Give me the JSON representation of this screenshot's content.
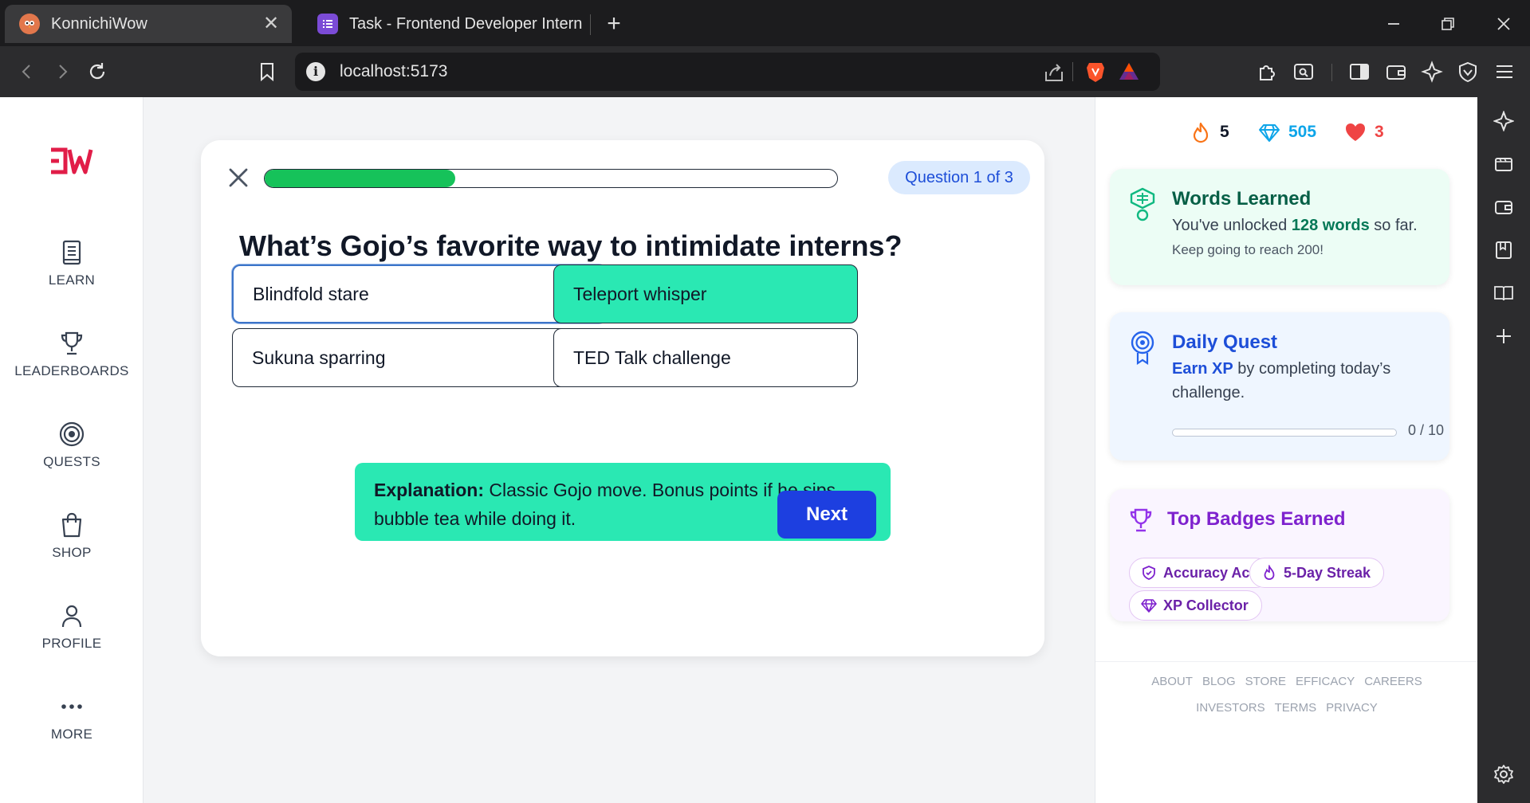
{
  "browser": {
    "tabs": [
      {
        "title": "KonnichiWow",
        "active": true
      },
      {
        "title": "Task - Frontend Developer Intern",
        "active": false
      }
    ],
    "url": "localhost:5173"
  },
  "sidebar": {
    "logo": "JW",
    "items": [
      {
        "label": "LEARN",
        "icon": "book-icon"
      },
      {
        "label": "LEADERBOARDS",
        "icon": "trophy-icon"
      },
      {
        "label": "QUESTS",
        "icon": "target-icon"
      },
      {
        "label": "SHOP",
        "icon": "shopping-bag-icon"
      },
      {
        "label": "PROFILE",
        "icon": "user-icon"
      },
      {
        "label": "MORE",
        "icon": "more-dots-icon"
      }
    ]
  },
  "quiz": {
    "progress_fraction": 0.333,
    "question_counter": "Question 1 of 3",
    "question": "What’s Gojo’s favorite way to intimidate interns?",
    "options": [
      "Blindfold stare",
      "Teleport whisper",
      "Sukuna sparring",
      "TED Talk challenge"
    ],
    "selected_option": "Blindfold stare",
    "correct_option": "Teleport whisper",
    "explanation_label": "Explanation:",
    "explanation_text": "Classic Gojo move. Bonus points if he sips bubble tea while doing it.",
    "next_label": "Next"
  },
  "stats": {
    "streak": "5",
    "gems": "505",
    "hearts": "3"
  },
  "words_card": {
    "title": "Words Learned",
    "text_prefix": "You've unlocked",
    "text_highlight": "128 words",
    "text_suffix": "so far.",
    "subtext": "Keep going to reach 200!"
  },
  "quest_card": {
    "title": "Daily Quest",
    "text_highlight": "Earn XP",
    "text_rest": "by completing today’s challenge.",
    "progress": "0 / 10",
    "progress_fraction": 0
  },
  "badges_card": {
    "title": "Top Badges Earned",
    "badges": [
      "Accuracy Ace",
      "5-Day Streak",
      "XP Collector"
    ]
  },
  "footer": {
    "row1": [
      "ABOUT",
      "BLOG",
      "STORE",
      "EFFICACY",
      "CAREERS"
    ],
    "row2": [
      "INVESTORS",
      "TERMS",
      "PRIVACY"
    ]
  },
  "colors": {
    "correct": "#2ae8b3",
    "progress": "#16c25a",
    "next_button": "#1d3fe0",
    "logo": "#e11d48",
    "gems": "#0ea5e9",
    "hearts": "#ef4444"
  }
}
